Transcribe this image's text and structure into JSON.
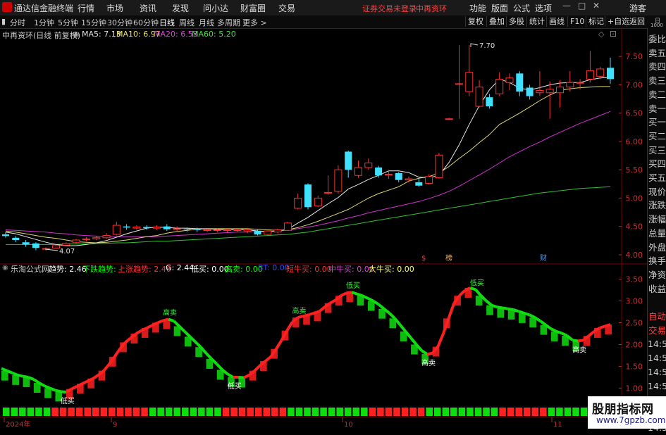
{
  "titlebar": {
    "app_title": "通达信金融终端",
    "menus": [
      "行情",
      "市场",
      "资讯",
      "发现",
      "问小达",
      "财富圈",
      "交易"
    ],
    "warning": "证券交易未登录",
    "stock": "中再资环",
    "right_menus": [
      "功能",
      "版面",
      "公式",
      "选项"
    ],
    "guest": "游客"
  },
  "toolbar": {
    "periods": [
      "分时",
      "1分钟",
      "5分钟",
      "15分钟",
      "30分钟",
      "60分钟",
      "日线",
      "周线",
      "月线",
      "多周期",
      "更多 >"
    ],
    "active_period": "日线",
    "right_buttons": [
      "复权",
      "叠加",
      "多股",
      "统计",
      "画线",
      "F10",
      "标记",
      "+自选",
      "返回"
    ]
  },
  "chart_title": "中再资环(日线 前复权)",
  "ma_legend": [
    {
      "label": "MA5: 7.13",
      "color": "#e0e0e0"
    },
    {
      "label": "MA10: 6.97",
      "color": "#e8e070"
    },
    {
      "label": "MA20: 6.53",
      "color": "#e040e0"
    },
    {
      "label": "MA60: 5.20",
      "color": "#40e040"
    }
  ],
  "indicator_legend": [
    {
      "label": "乐淘公式网",
      "color": "#cccccc"
    },
    {
      "label": "趋势: 2.46",
      "color": "#ffffff"
    },
    {
      "label": "下跌趋势: -",
      "color": "#00ff00"
    },
    {
      "label": "上涨趋势: 2.46",
      "color": "#ff3030"
    },
    {
      "label": "G: 2.44",
      "color": "#ffffff"
    },
    {
      "label": "低买: 0.00",
      "color": "#ffffff"
    },
    {
      "label": "高卖: 0.00",
      "color": "#00ff00"
    },
    {
      "label": "BT: 0.00",
      "color": "#3050ff"
    },
    {
      "label": "短牛买: 0.00",
      "color": "#ff3030"
    },
    {
      "label": "中牛买: 0.00",
      "color": "#e040e0"
    },
    {
      "label": "大牛买: 0.00",
      "color": "#ffff60"
    }
  ],
  "sidebar": [
    "委比",
    "卖五",
    "卖四",
    "卖三",
    "卖二",
    "卖一",
    "买一",
    "买二",
    "买三",
    "买四",
    "买五",
    "现价",
    "涨跌",
    "涨幅",
    "总量",
    "外盘",
    "换手",
    "净资",
    "收益",
    "",
    "自动",
    "交易",
    "14:56",
    "14:56",
    "14:56",
    "14:56",
    "14:56",
    "14:56",
    "14:56"
  ],
  "sidebar_top": [
    "日",
    "1000"
  ],
  "price_axis": [
    "7.50",
    "7.00",
    "6.50",
    "6.00",
    "5.50",
    "5.00",
    "4.50",
    "4.00"
  ],
  "ind_axis": [
    "3.50",
    "3.00",
    "2.50",
    "2.00",
    "1.50",
    "1.00"
  ],
  "date_axis": [
    "2024年",
    "9",
    "10",
    "11"
  ],
  "annotations": {
    "high": "7.70",
    "low": "4.07"
  },
  "event_marks": [
    {
      "text": "$",
      "color": "#ff4040"
    },
    {
      "text": "榜",
      "color": "#e0b060"
    },
    {
      "text": "财",
      "color": "#40a0ff"
    }
  ],
  "signals": [
    "低买",
    "高卖",
    "低买",
    "高卖",
    "低买",
    "高卖",
    "低买",
    "高卖",
    "低买"
  ],
  "watermark": {
    "line1": "股朋指标网",
    "line2": "www.7gpzb.com"
  },
  "colors": {
    "up": "#ff3030",
    "down": "#40e0ff",
    "bg": "#000000"
  },
  "chart_data": {
    "type": "candlestick",
    "ylim": [
      3.85,
      7.95
    ],
    "candles": [
      [
        4.36,
        4.33,
        4.4,
        4.3
      ],
      [
        4.3,
        4.26,
        4.33,
        4.22
      ],
      [
        4.22,
        4.18,
        4.26,
        4.14
      ],
      [
        4.2,
        4.12,
        4.22,
        4.08
      ],
      [
        4.1,
        4.11,
        4.13,
        4.07
      ],
      [
        4.12,
        4.16,
        4.18,
        4.11
      ],
      [
        4.17,
        4.2,
        4.22,
        4.15
      ],
      [
        4.22,
        4.26,
        4.28,
        4.2
      ],
      [
        4.27,
        4.28,
        4.31,
        4.24
      ],
      [
        4.28,
        4.3,
        4.33,
        4.26
      ],
      [
        4.3,
        4.34,
        4.38,
        4.28
      ],
      [
        4.36,
        4.52,
        4.58,
        4.34
      ],
      [
        4.5,
        4.48,
        4.54,
        4.44
      ],
      [
        4.47,
        4.49,
        4.52,
        4.44
      ],
      [
        4.49,
        4.47,
        4.52,
        4.44
      ],
      [
        4.47,
        4.49,
        4.52,
        4.44
      ],
      [
        4.5,
        4.45,
        4.54,
        4.42
      ],
      [
        4.45,
        4.46,
        4.5,
        4.42
      ],
      [
        4.46,
        4.45,
        4.48,
        4.41
      ],
      [
        4.45,
        4.44,
        4.48,
        4.4
      ],
      [
        4.44,
        4.44,
        4.46,
        4.4
      ],
      [
        4.43,
        4.44,
        4.46,
        4.4
      ],
      [
        4.43,
        4.44,
        4.46,
        4.4
      ],
      [
        4.43,
        4.44,
        4.46,
        4.4
      ],
      [
        4.42,
        4.44,
        4.46,
        4.38
      ],
      [
        4.42,
        4.36,
        4.44,
        4.34
      ],
      [
        4.36,
        4.42,
        4.44,
        4.34
      ],
      [
        4.4,
        4.44,
        4.46,
        4.38
      ],
      [
        4.43,
        4.56,
        4.58,
        4.42
      ],
      [
        4.82,
        5.0,
        5.08,
        4.8
      ],
      [
        5.24,
        4.84,
        5.26,
        4.8
      ],
      [
        4.86,
        5.0,
        5.04,
        4.84
      ],
      [
        5.1,
        5.1,
        5.4,
        5.06
      ],
      [
        5.12,
        5.5,
        5.58,
        5.08
      ],
      [
        5.82,
        5.5,
        5.84,
        5.36
      ],
      [
        5.4,
        5.54,
        5.66,
        5.36
      ],
      [
        5.54,
        5.62,
        5.7,
        5.5
      ],
      [
        5.54,
        5.4,
        5.57,
        5.36
      ],
      [
        5.42,
        5.42,
        5.5,
        5.34
      ],
      [
        5.44,
        5.32,
        5.46,
        5.28
      ],
      [
        5.32,
        5.34,
        5.38,
        5.28
      ],
      [
        5.28,
        5.22,
        5.34,
        5.2
      ],
      [
        5.26,
        5.38,
        5.42,
        5.24
      ],
      [
        5.36,
        5.76,
        5.8,
        5.34
      ],
      [
        6.4,
        6.4,
        6.42,
        6.38
      ],
      [
        7.02,
        7.02,
        7.7,
        6.4
      ],
      [
        6.88,
        7.22,
        7.7,
        6.8
      ],
      [
        6.62,
        6.96,
        7.08,
        6.6
      ],
      [
        6.78,
        6.62,
        6.84,
        6.58
      ],
      [
        6.84,
        7.1,
        7.22,
        6.8
      ],
      [
        7.04,
        7.12,
        7.2,
        6.9
      ],
      [
        7.2,
        6.88,
        7.24,
        6.8
      ],
      [
        6.95,
        6.8,
        7.0,
        6.74
      ],
      [
        6.86,
        6.9,
        7.24,
        6.8
      ],
      [
        6.86,
        6.92,
        7.06,
        6.4
      ],
      [
        6.86,
        6.96,
        7.08,
        6.6
      ],
      [
        6.96,
        7.04,
        7.24,
        6.88
      ],
      [
        7.04,
        7.04,
        7.1,
        6.92
      ],
      [
        7.1,
        7.25,
        7.6,
        7.04
      ],
      [
        7.15,
        7.28,
        7.32,
        7.1
      ],
      [
        7.3,
        7.1,
        7.48,
        7.02
      ]
    ],
    "ma5": [
      4.4,
      4.37,
      4.32,
      4.27,
      4.22,
      4.18,
      4.16,
      4.16,
      4.18,
      4.21,
      4.25,
      4.31,
      4.37,
      4.42,
      4.47,
      4.49,
      4.48,
      4.47,
      4.47,
      4.46,
      4.46,
      4.45,
      4.44,
      4.44,
      4.44,
      4.42,
      4.41,
      4.42,
      4.45,
      4.56,
      4.66,
      4.78,
      4.9,
      5.01,
      5.16,
      5.24,
      5.33,
      5.4,
      5.48,
      5.48,
      5.45,
      5.37,
      5.36,
      5.4,
      5.63,
      5.94,
      6.3,
      6.63,
      6.91,
      7.1,
      7.04,
      6.94,
      6.91,
      6.95,
      7.0,
      7.03,
      7.04,
      7.04,
      7.09,
      7.12,
      7.13
    ],
    "ma10": [
      4.42,
      4.4,
      4.37,
      4.34,
      4.31,
      4.29,
      4.26,
      4.23,
      4.22,
      4.21,
      4.22,
      4.24,
      4.26,
      4.29,
      4.32,
      4.34,
      4.38,
      4.41,
      4.43,
      4.45,
      4.46,
      4.46,
      4.46,
      4.46,
      4.46,
      4.45,
      4.44,
      4.43,
      4.44,
      4.48,
      4.53,
      4.59,
      4.66,
      4.73,
      4.8,
      4.9,
      5.0,
      5.08,
      5.14,
      5.2,
      5.3,
      5.35,
      5.38,
      5.44,
      5.56,
      5.7,
      5.83,
      5.98,
      6.12,
      6.3,
      6.4,
      6.5,
      6.61,
      6.72,
      6.82,
      6.9,
      6.93,
      6.95,
      6.96,
      6.97,
      6.97
    ],
    "ma20": [
      4.44,
      4.43,
      4.42,
      4.41,
      4.4,
      4.38,
      4.37,
      4.35,
      4.34,
      4.33,
      4.32,
      4.32,
      4.32,
      4.32,
      4.32,
      4.32,
      4.33,
      4.34,
      4.35,
      4.36,
      4.37,
      4.38,
      4.39,
      4.4,
      4.4,
      4.41,
      4.41,
      4.42,
      4.43,
      4.46,
      4.49,
      4.52,
      4.56,
      4.6,
      4.65,
      4.69,
      4.74,
      4.78,
      4.82,
      4.86,
      4.9,
      4.94,
      4.99,
      5.05,
      5.12,
      5.21,
      5.31,
      5.41,
      5.51,
      5.62,
      5.73,
      5.82,
      5.91,
      5.99,
      6.08,
      6.16,
      6.24,
      6.32,
      6.39,
      6.46,
      6.53
    ],
    "ma60": [
      4.18,
      4.18,
      4.18,
      4.18,
      4.18,
      4.18,
      4.19,
      4.19,
      4.19,
      4.2,
      4.2,
      4.21,
      4.21,
      4.22,
      4.23,
      4.24,
      4.24,
      4.25,
      4.26,
      4.27,
      4.28,
      4.29,
      4.3,
      4.31,
      4.32,
      4.33,
      4.34,
      4.35,
      4.36,
      4.38,
      4.4,
      4.43,
      4.46,
      4.49,
      4.52,
      4.55,
      4.58,
      4.61,
      4.64,
      4.67,
      4.7,
      4.73,
      4.76,
      4.79,
      4.82,
      4.85,
      4.88,
      4.91,
      4.94,
      4.97,
      5.0,
      5.03,
      5.06,
      5.09,
      5.11,
      5.13,
      5.15,
      5.17,
      5.18,
      5.19,
      5.2
    ],
    "indicator": {
      "ylim": [
        0.7,
        3.8
      ],
      "trend": [
        1.45,
        1.4,
        1.35,
        1.3,
        1.27,
        1.25,
        1.2,
        1.12,
        1.05,
        1.0,
        0.95,
        0.92,
        0.91,
        0.98,
        1.04,
        1.1,
        1.16,
        1.22,
        1.3,
        1.4,
        1.55,
        1.72,
        1.9,
        2.05,
        2.15,
        2.25,
        2.32,
        2.38,
        2.44,
        2.5,
        2.55,
        2.58,
        2.54,
        2.42,
        2.3,
        2.18,
        2.06,
        1.94,
        1.8,
        1.67,
        1.55,
        1.42,
        1.32,
        1.25,
        1.25,
        1.24,
        1.3,
        1.4,
        1.52,
        1.62,
        1.72,
        1.9,
        2.1,
        2.32,
        2.52,
        2.62,
        2.65,
        2.68,
        2.72,
        2.76,
        2.86,
        2.95,
        3.02,
        3.12,
        3.18,
        3.2,
        3.16,
        3.12,
        3.06,
        3.0,
        2.92,
        2.82,
        2.72,
        2.6,
        2.45,
        2.3,
        2.15,
        2.0,
        1.86,
        1.78,
        1.8,
        1.95,
        2.25,
        2.6,
        2.95,
        3.12,
        3.24,
        3.3,
        3.26,
        3.12,
        3.0,
        2.9,
        2.86,
        2.84,
        2.82,
        2.8,
        2.76,
        2.72,
        2.68,
        2.62,
        2.54,
        2.45,
        2.36,
        2.3,
        2.26,
        2.2,
        2.1,
        2.08,
        2.1,
        2.2,
        2.3,
        2.38,
        2.42,
        2.46
      ],
      "bottom_bars_color": [
        "g",
        "g",
        "g",
        "g",
        "g",
        "g",
        "r",
        "r",
        "r",
        "r",
        "r",
        "r",
        "r",
        "r",
        "r",
        "r",
        "r",
        "r",
        "g",
        "g",
        "g",
        "g",
        "g",
        "g",
        "g",
        "g",
        "g",
        "r",
        "r",
        "r",
        "r",
        "r",
        "r",
        "r",
        "r",
        "g",
        "g",
        "g",
        "g",
        "g",
        "g",
        "g",
        "g",
        "g",
        "g",
        "r",
        "r",
        "r",
        "r",
        "r",
        "r",
        "r",
        "g",
        "g",
        "g",
        "g",
        "g",
        "g",
        "g",
        "g",
        "g",
        "r",
        "r",
        "r",
        "r",
        "r",
        "r",
        "g",
        "g",
        "g",
        "g",
        "g",
        "g",
        "g",
        "g"
      ]
    }
  }
}
